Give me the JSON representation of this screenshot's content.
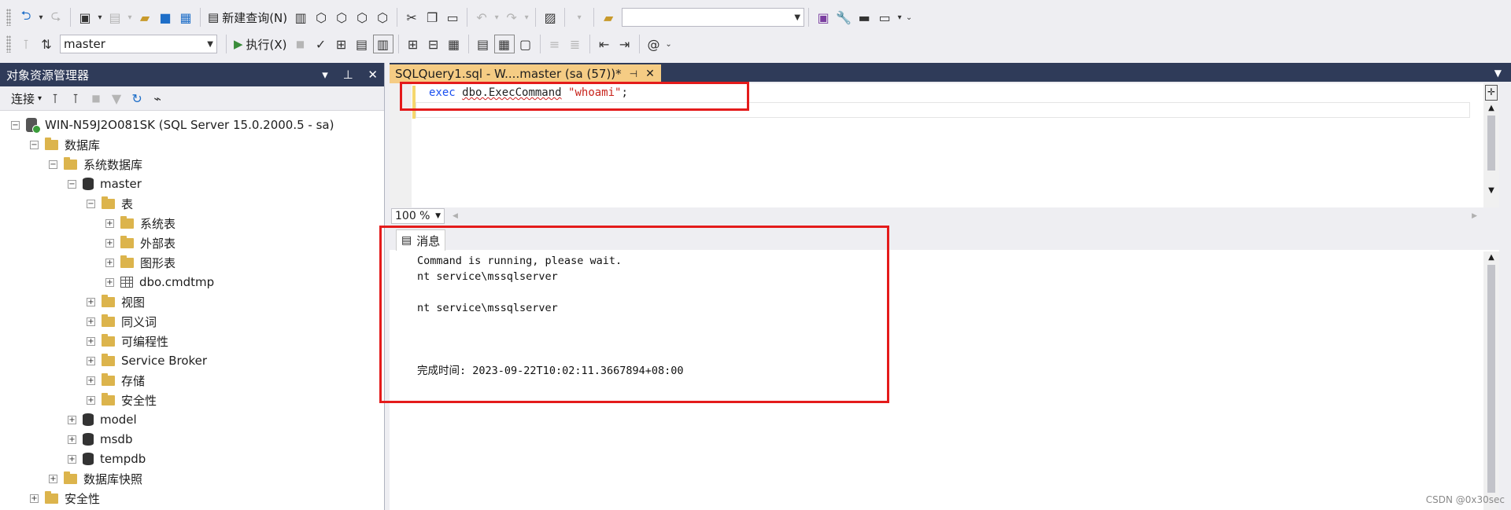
{
  "toolbar1": {
    "new_query_label": "新建查询(N)",
    "solution_combo_value": ""
  },
  "toolbar2": {
    "database_combo_value": "master",
    "execute_label": "执行(X)"
  },
  "object_explorer": {
    "title": "对象资源管理器",
    "connect_label": "连接",
    "tree": {
      "server": "WIN-N59J2O081SK (SQL Server 15.0.2000.5 - sa)",
      "databases": "数据库",
      "system_databases": "系统数据库",
      "master": "master",
      "tables": "表",
      "system_tables": "系统表",
      "external_tables": "外部表",
      "graph_tables": "图形表",
      "cmdtmp": "dbo.cmdtmp",
      "views": "视图",
      "synonyms": "同义词",
      "programmability": "可编程性",
      "service_broker": "Service Broker",
      "storage": "存储",
      "security_master": "安全性",
      "model": "model",
      "msdb": "msdb",
      "tempdb": "tempdb",
      "snapshots": "数据库快照",
      "security": "安全性"
    }
  },
  "editor": {
    "tab_title": "SQLQuery1.sql - W....master (sa (57))*",
    "code_keyword": "exec",
    "code_object": "dbo.ExecCommand",
    "code_string": "\"whoami\"",
    "code_end": ";",
    "zoom": "100 %"
  },
  "results": {
    "tab_label": "消息",
    "line1": "Command is running, please wait.",
    "line2": "nt service\\mssqlserver",
    "line3": "nt service\\mssqlserver",
    "completion_label": "完成时间:",
    "completion_time": "2023-09-22T10:02:11.3667894+08:00"
  },
  "watermark": "CSDN @0x30sec",
  "colors": {
    "title_dark": "#2f3b59",
    "active_tab": "#f5cc84",
    "highlight_box": "#e41b1b",
    "keyword": "#1a4ff0",
    "string": "#c8241c"
  }
}
